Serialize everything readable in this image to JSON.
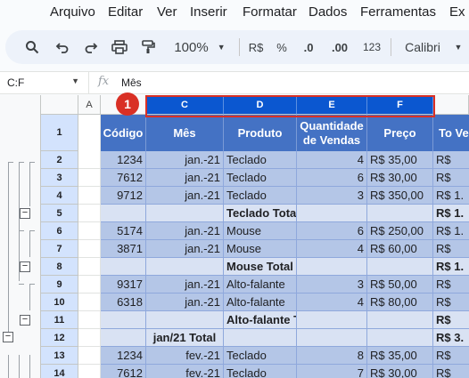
{
  "menu": [
    "Arquivo",
    "Editar",
    "Ver",
    "Inserir",
    "Formatar",
    "Dados",
    "Ferramentas",
    "Ex"
  ],
  "toolbar": {
    "zoom": "100%",
    "currency": "R$",
    "percent": "%",
    "dec_decrease": ".0",
    "dec_increase": ".00",
    "number_format": "123",
    "font": "Calibri"
  },
  "namebox": "C:F",
  "formula": "Mês",
  "callout": "1",
  "colors": {
    "header_fill": "#4472c4",
    "band_dark": "#b4c6e7",
    "band_light": "#d9e2f3",
    "selection": "#d93025",
    "col_selected": "#0b57d0"
  },
  "columns": [
    "A",
    "C",
    "D",
    "E",
    "F"
  ],
  "header": [
    "Código",
    "Mês",
    "Produto",
    "Quantidade de Vendas",
    "Preço",
    "To Ve"
  ],
  "rows": [
    {
      "n": "1"
    },
    {
      "n": "2",
      "cells": [
        "1234",
        "jan.-21",
        "Teclado",
        "4",
        "R$   35,00",
        "R$"
      ]
    },
    {
      "n": "3",
      "cells": [
        "7612",
        "jan.-21",
        "Teclado",
        "6",
        "R$   30,00",
        "R$"
      ]
    },
    {
      "n": "4",
      "cells": [
        "9712",
        "jan.-21",
        "Teclado",
        "3",
        "R$ 350,00",
        "R$ 1."
      ]
    },
    {
      "n": "5",
      "cells": [
        "",
        "",
        "Teclado Total",
        "",
        "",
        "R$ 1."
      ]
    },
    {
      "n": "6",
      "cells": [
        "5174",
        "jan.-21",
        "Mouse",
        "6",
        "R$ 250,00",
        "R$ 1."
      ]
    },
    {
      "n": "7",
      "cells": [
        "3871",
        "jan.-21",
        "Mouse",
        "4",
        "R$   60,00",
        "R$"
      ]
    },
    {
      "n": "8",
      "cells": [
        "",
        "",
        "Mouse Total",
        "",
        "",
        "R$ 1."
      ]
    },
    {
      "n": "9",
      "cells": [
        "9317",
        "jan.-21",
        "Alto-falante",
        "3",
        "R$   50,00",
        "R$"
      ]
    },
    {
      "n": "10",
      "cells": [
        "6318",
        "jan.-21",
        "Alto-falante",
        "4",
        "R$   80,00",
        "R$"
      ]
    },
    {
      "n": "11",
      "cells": [
        "",
        "",
        "Alto-falante Total",
        "",
        "",
        "R$"
      ]
    },
    {
      "n": "12",
      "cells": [
        "",
        "jan/21 Total",
        "",
        "",
        "",
        "R$ 3."
      ]
    },
    {
      "n": "13",
      "cells": [
        "1234",
        "fev.-21",
        "Teclado",
        "8",
        "R$   35,00",
        "R$"
      ]
    },
    {
      "n": "14",
      "cells": [
        "7612",
        "fev.-21",
        "Teclado",
        "7",
        "R$   30,00",
        "R$"
      ]
    }
  ]
}
